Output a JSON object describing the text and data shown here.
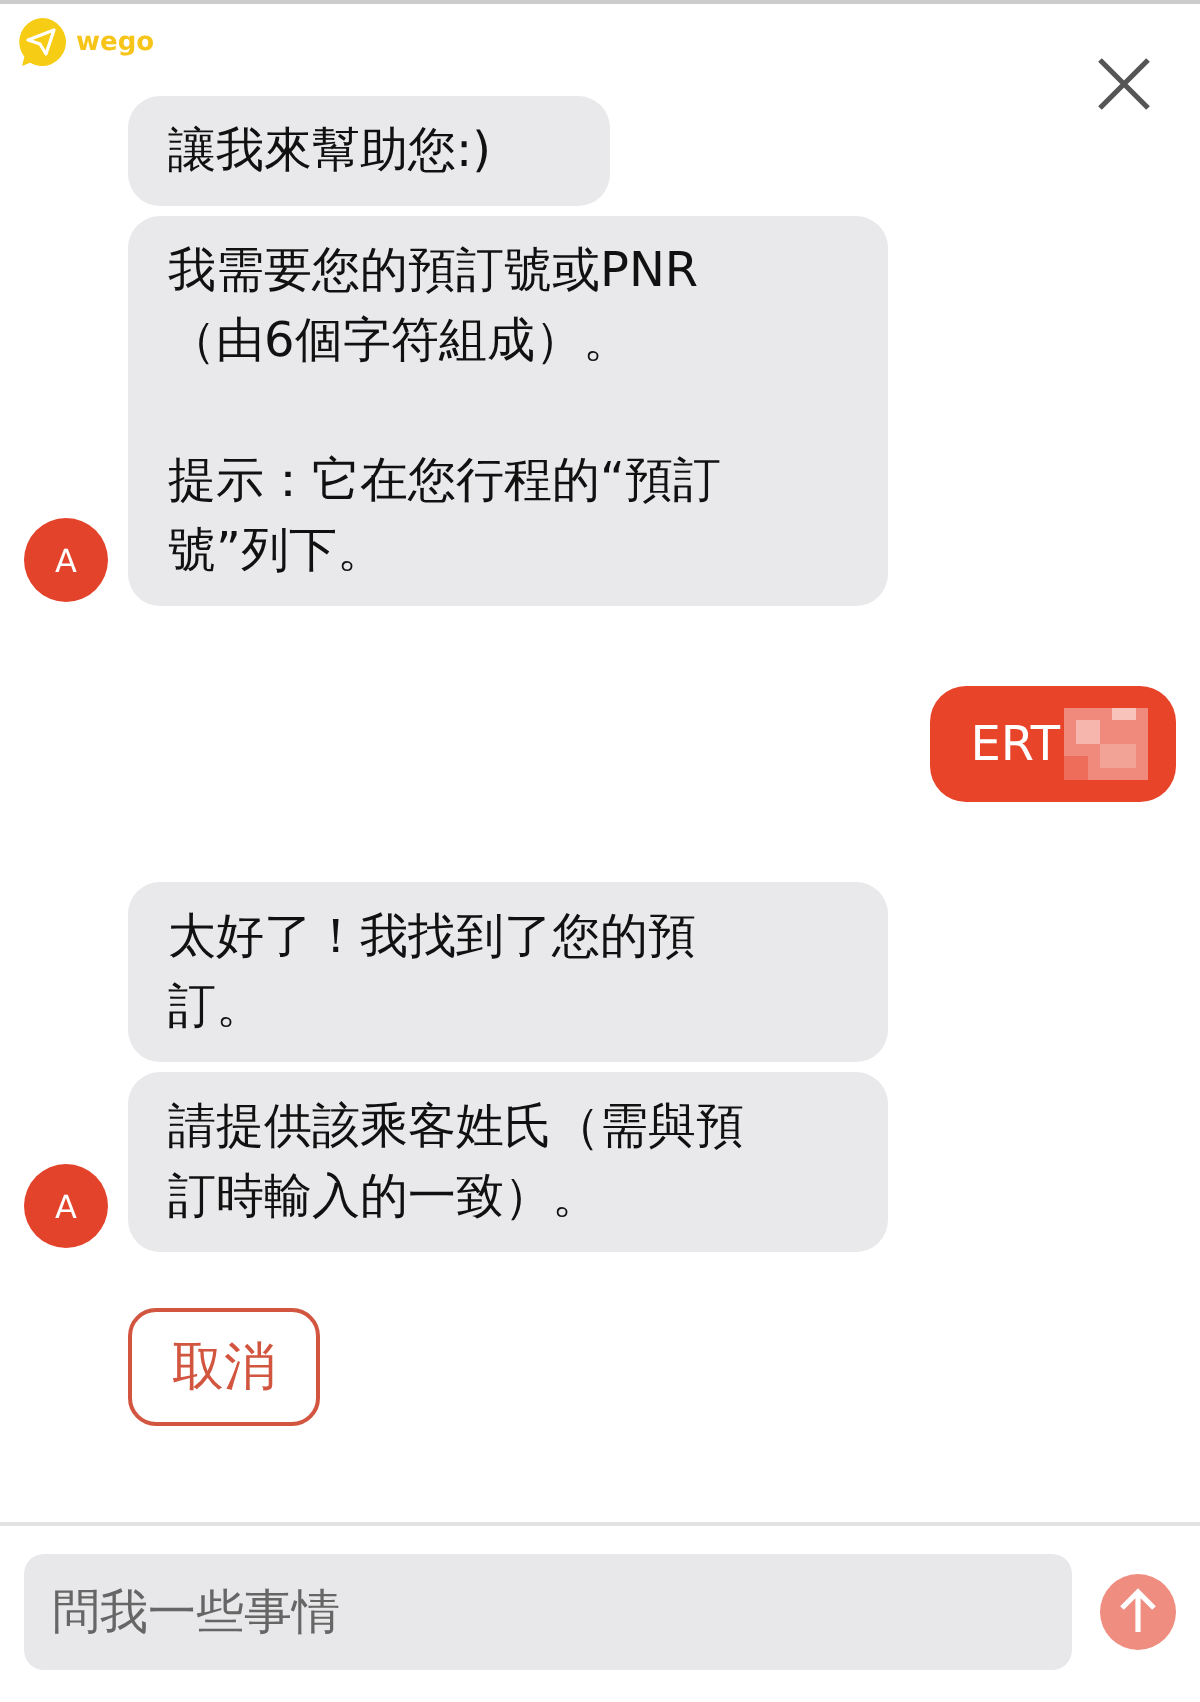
{
  "header": {
    "logo_text": "wego"
  },
  "messages": [
    {
      "kind": "bot",
      "avatar": "A",
      "bubbles": [
        {
          "paragraphs": [
            "讓我來幫助您:)"
          ]
        },
        {
          "paragraphs": [
            "我需要您的預訂號或PNR（由6個字符組成）。",
            "提示：它在您行程的“預訂號”列下。"
          ]
        }
      ]
    },
    {
      "kind": "user",
      "text": "ERT",
      "redacted": true
    },
    {
      "kind": "bot",
      "avatar": "A",
      "bubbles": [
        {
          "paragraphs": [
            "太好了！我找到了您的預訂。"
          ]
        },
        {
          "paragraphs": [
            "請提供該乘客姓氏（需與預訂時輸入的一致）。"
          ]
        }
      ]
    }
  ],
  "quick_replies": [
    "取消"
  ],
  "composer": {
    "placeholder": "問我一些事情",
    "send_disabled": true
  }
}
